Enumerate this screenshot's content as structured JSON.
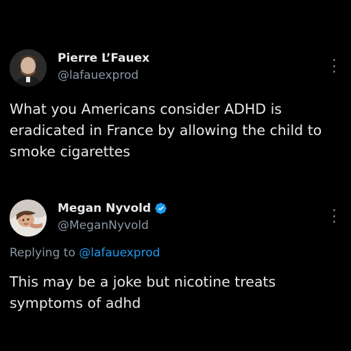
{
  "tweets": [
    {
      "display_name": "Pierre L’Fauex",
      "handle": "@lafauexprod",
      "text": "What you Americans consider ADHD is eradicated in France by allowing the child to smoke cigarettes",
      "verified": false
    },
    {
      "display_name": "Megan Nyvold",
      "handle": "@MeganNyvold",
      "reply_prefix": "Replying to",
      "reply_to": "@lafauexprod",
      "text": "This may be a joke but nicotine treats symptoms of adhd",
      "verified": true
    }
  ],
  "icons": {
    "more": "more-options-icon",
    "verified": "verified-badge-icon"
  },
  "colors": {
    "background": "#000000",
    "primary_text": "#e7e9ea",
    "secondary_text": "#8b98a5",
    "accent": "#1d9bf0"
  }
}
